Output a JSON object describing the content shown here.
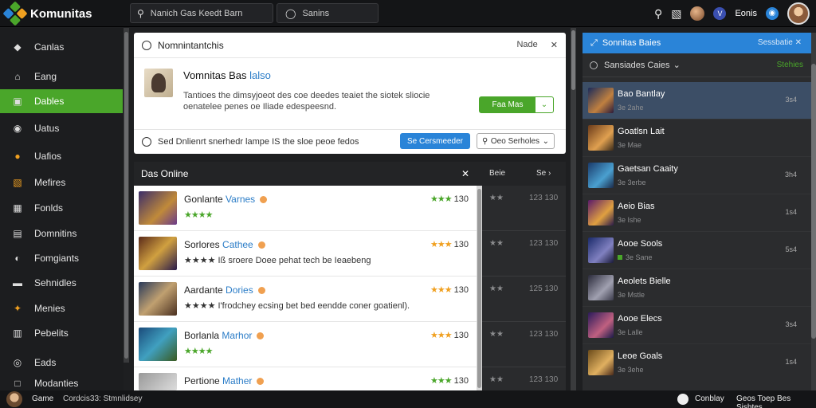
{
  "app": {
    "title": "Komunitas"
  },
  "colors": {
    "accent_green": "#4aa62a",
    "accent_blue": "#2a84d8",
    "bg_dark": "#1e1f21"
  },
  "topbar": {
    "search_placeholder": "Nanich Gas Keedt Barn",
    "search2_label": "Sanins",
    "user_name": "Eonis",
    "icons": [
      "search-icon",
      "bell-icon",
      "avatar",
      "shield-icon",
      "globe-icon",
      "profile-avatar"
    ]
  },
  "sidebar": {
    "items": [
      {
        "label": "Canlas",
        "icon": "◆"
      },
      {
        "label": "Eang",
        "icon": "⌂"
      },
      {
        "label": "Dables",
        "icon": "▣"
      },
      {
        "label": "Uatus",
        "icon": "◉"
      },
      {
        "label": "Uafios",
        "icon": "●"
      },
      {
        "label": "Mefires",
        "icon": "▧"
      },
      {
        "label": "Fonlds",
        "icon": "▦"
      },
      {
        "label": "Domnitins",
        "icon": "▤"
      },
      {
        "label": "Fomgiants",
        "icon": "◐"
      },
      {
        "label": "Sehnidles",
        "icon": "▬"
      },
      {
        "label": "Menies",
        "icon": "✦"
      },
      {
        "label": "Pebelits",
        "icon": "▥"
      },
      {
        "label": "Eads",
        "icon": "◎"
      },
      {
        "label": "Modanties",
        "icon": "□"
      }
    ]
  },
  "community": {
    "header_title": "Nomnintantchis",
    "header_right": "Nade",
    "title_main": "Vomnitas Bas",
    "title_link": "lalso",
    "desc": "Tantioes the dimsyjoeot des coe deedes teaiet the siotek sliocie oenatelee penes oe Iliade edespeesnd.",
    "join_label": "Faa Mas",
    "footer_text": "Sed Dnlienrt snerhedr lampe IS the sloe peoe fedos",
    "blue_btn": "Se Cersmeeder",
    "outline_btn": "Oeo Serholes"
  },
  "list": {
    "header": "Das Online",
    "col2": "Beie",
    "col3": "Se",
    "rows": [
      {
        "title": "Gonlante",
        "title_blue": "Varnes",
        "sub": "★★★★",
        "sub_type": "green",
        "rating": "★★★",
        "rating_type": "green",
        "score": "130",
        "d_score": "123 130"
      },
      {
        "title": "Sorlores",
        "title_blue": "Cathee",
        "sub": "★★★★ Iß sroere Doee pehat tech be Ieaebeng",
        "sub_type": "orange",
        "rating": "★★★",
        "rating_type": "orange",
        "score": "130",
        "d_score": "123 130"
      },
      {
        "title": "Aardante",
        "title_blue": "Dories",
        "sub": "★★★★ I'frodchey ecsing bet bed eendde coner goatienl).",
        "sub_type": "orange",
        "rating": "★★★",
        "rating_type": "orange",
        "score": "130",
        "d_score": "125 130"
      },
      {
        "title": "Borlanla",
        "title_blue": "Marhor",
        "sub": "★★★★",
        "sub_type": "green",
        "rating": "★★★",
        "rating_type": "orange",
        "score": "130",
        "d_score": "123 130"
      },
      {
        "title": "Pertione",
        "title_blue": "Mather",
        "sub": "",
        "sub_type": "green",
        "rating": "★★★",
        "rating_type": "green",
        "score": "130",
        "d_score": "123 130"
      }
    ]
  },
  "right_panel": {
    "header": "Sonnitas Baies",
    "header_right": "Sessbatie",
    "sub_label": "Sansiades Caies",
    "sub_right": "Stehies",
    "items": [
      {
        "name": "Bao Bantlay",
        "meta": "3e 2ahe",
        "x": "3s4"
      },
      {
        "name": "Goatlsn Lait",
        "meta": "3e Mae",
        "x": ""
      },
      {
        "name": "Gaetsan Caaity",
        "meta": "3e 3erbe",
        "x": "3h4"
      },
      {
        "name": "Aeio Bias",
        "meta": "3e Ishe",
        "x": "1s4"
      },
      {
        "name": "Aooe Sools",
        "meta": "3e Sane",
        "x": "5s4"
      },
      {
        "name": "Aeolets Bielle",
        "meta": "3e Mstle",
        "x": ""
      },
      {
        "name": "Aooe Elecs",
        "meta": "3e Lalle",
        "x": "3s4"
      },
      {
        "name": "Leoe Goals",
        "meta": "3e 3ehe",
        "x": "1s4"
      }
    ]
  },
  "bottombar": {
    "game": "Game",
    "status": "Cordcis33: Stmnlidsey",
    "right1": "Conblay",
    "right2": "Geos Toep Bes Sishtes"
  }
}
